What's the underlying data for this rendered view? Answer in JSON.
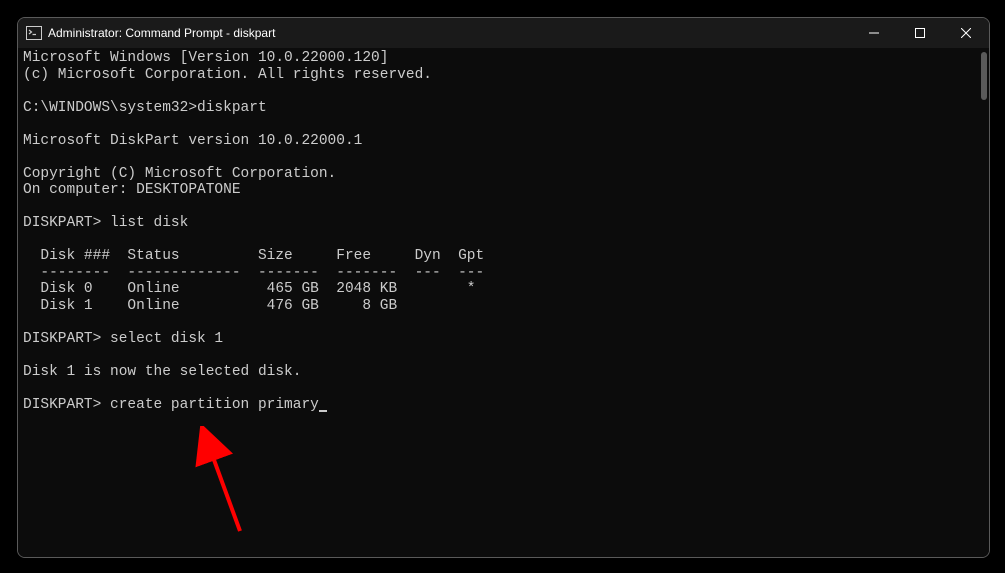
{
  "titlebar": {
    "title": "Administrator: Command Prompt - diskpart"
  },
  "lines": {
    "l1": "Microsoft Windows [Version 10.0.22000.120]",
    "l2": "(c) Microsoft Corporation. All rights reserved.",
    "l3": "",
    "l4": "C:\\WINDOWS\\system32>diskpart",
    "l5": "",
    "l6": "Microsoft DiskPart version 10.0.22000.1",
    "l7": "",
    "l8": "Copyright (C) Microsoft Corporation.",
    "l9": "On computer: DESKTOPATONE",
    "l10": "",
    "l11": "DISKPART> list disk",
    "l12": "",
    "l13": "  Disk ###  Status         Size     Free     Dyn  Gpt",
    "l14": "  --------  -------------  -------  -------  ---  ---",
    "l15": "  Disk 0    Online          465 GB  2048 KB        *",
    "l16": "  Disk 1    Online          476 GB     8 GB",
    "l17": "",
    "l18": "DISKPART> select disk 1",
    "l19": "",
    "l20": "Disk 1 is now the selected disk.",
    "l21": "",
    "l22": "DISKPART> create partition primary"
  }
}
